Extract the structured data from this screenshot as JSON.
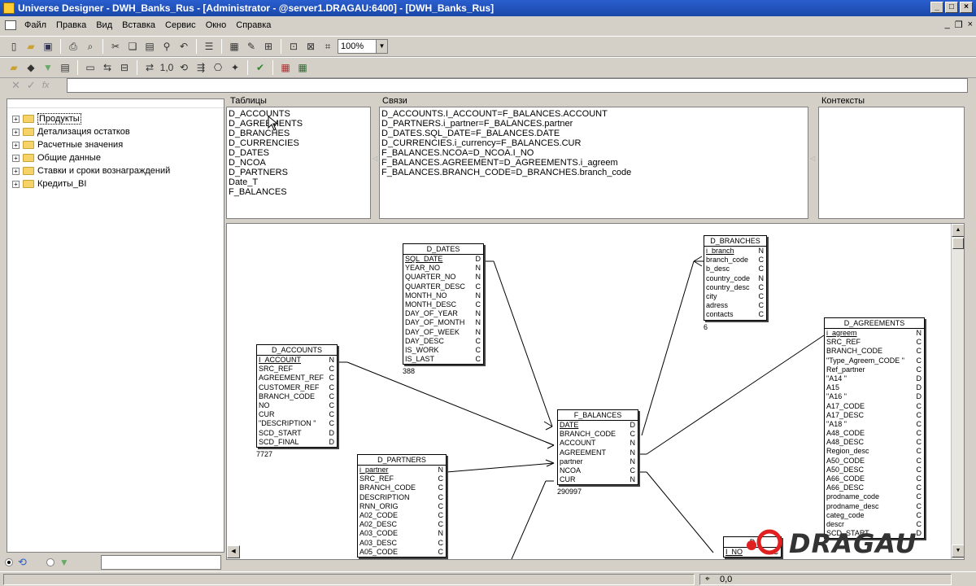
{
  "window": {
    "title": "Universe Designer - DWH_Banks_Rus - [Administrator - @server1.DRAGAU:6400] - [DWH_Banks_Rus]"
  },
  "menu": [
    "Файл",
    "Правка",
    "Вид",
    "Вставка",
    "Сервис",
    "Окно",
    "Справка"
  ],
  "toolbar": {
    "zoom": "100%"
  },
  "tree": {
    "items": [
      "Продукты",
      "Детализация остатков",
      "Расчетные значения",
      "Общие данные",
      "Ставки и сроки вознаграждений",
      "Кредиты_BI"
    ]
  },
  "panels": {
    "tables": {
      "label": "Таблицы",
      "items": [
        "D_ACCOUNTS",
        "D_AGREEMENTS",
        "D_BRANCHES",
        "D_CURRENCIES",
        "D_DATES",
        "D_NCOA",
        "D_PARTNERS",
        "Date_T",
        "F_BALANCES"
      ]
    },
    "joins": {
      "label": "Связи",
      "items": [
        "D_ACCOUNTS.I_ACCOUNT=F_BALANCES.ACCOUNT",
        "D_PARTNERS.i_partner=F_BALANCES.partner",
        "D_DATES.SQL_DATE=F_BALANCES.DATE",
        "D_CURRENCIES.i_currency=F_BALANCES.CUR",
        "F_BALANCES.NCOA=D_NCOA.I_NO",
        "F_BALANCES.AGREEMENT=D_AGREEMENTS.i_agreem",
        "F_BALANCES.BRANCH_CODE=D_BRANCHES.branch_code"
      ]
    },
    "contexts": {
      "label": "Контексты",
      "items": []
    }
  },
  "tables": {
    "d_dates": {
      "name": "D_DATES",
      "count": "388",
      "cols": [
        [
          "SQL_DATE",
          "D"
        ],
        [
          "YEAR_NO",
          "N"
        ],
        [
          "QUARTER_NO",
          "N"
        ],
        [
          "QUARTER_DESC",
          "C"
        ],
        [
          "MONTH_NO",
          "N"
        ],
        [
          "MONTH_DESC",
          "C"
        ],
        [
          "DAY_OF_YEAR",
          "N"
        ],
        [
          "DAY_OF_MONTH",
          "N"
        ],
        [
          "DAY_OF_WEEK",
          "N"
        ],
        [
          "DAY_DESC",
          "C"
        ],
        [
          "IS_WORK",
          "C"
        ],
        [
          "IS_LAST",
          "C"
        ]
      ]
    },
    "d_branches": {
      "name": "D_BRANCHES",
      "count": "6",
      "cols": [
        [
          "i_branch",
          "N"
        ],
        [
          "branch_code",
          "C"
        ],
        [
          "b_desc",
          "C"
        ],
        [
          "country_code",
          "N"
        ],
        [
          "country_desc",
          "C"
        ],
        [
          "city",
          "C"
        ],
        [
          "adress",
          "C"
        ],
        [
          "contacts",
          "C"
        ]
      ]
    },
    "d_accounts": {
      "name": "D_ACCOUNTS",
      "count": "7727",
      "cols": [
        [
          "I_ACCOUNT",
          "N"
        ],
        [
          "SRC_REF",
          "C"
        ],
        [
          "AGREEMENT_REF",
          "C"
        ],
        [
          "CUSTOMER_REF",
          "C"
        ],
        [
          "BRANCH_CODE",
          "C"
        ],
        [
          "NO",
          "C"
        ],
        [
          "CUR",
          "C"
        ],
        [
          "\"DESCRIPTION \"",
          "C"
        ],
        [
          "SCD_START",
          "D"
        ],
        [
          "SCD_FINAL",
          "D"
        ]
      ]
    },
    "f_balances": {
      "name": "F_BALANCES",
      "count": "290997",
      "cols": [
        [
          "DATE",
          "D"
        ],
        [
          "BRANCH_CODE",
          "C"
        ],
        [
          "ACCOUNT",
          "N"
        ],
        [
          "AGREEMENT",
          "N"
        ],
        [
          "partner",
          "N"
        ],
        [
          "NCOA",
          "C"
        ],
        [
          "CUR",
          "N"
        ]
      ]
    },
    "d_partners": {
      "name": "D_PARTNERS",
      "cols": [
        [
          "i_partner",
          "N"
        ],
        [
          "SRC_REF",
          "C"
        ],
        [
          "BRANCH_CODE",
          "C"
        ],
        [
          "DESCRIPTION",
          "C"
        ],
        [
          "RNN_ORIG",
          "C"
        ],
        [
          "A02_CODE",
          "C"
        ],
        [
          "A02_DESC",
          "C"
        ],
        [
          "A03_CODE",
          "N"
        ],
        [
          "A03_DESC",
          "C"
        ],
        [
          "A05_CODE",
          "C"
        ]
      ]
    },
    "d_agreements": {
      "name": "D_AGREEMENTS",
      "cols": [
        [
          "i_agreem",
          "N"
        ],
        [
          "SRC_REF",
          "C"
        ],
        [
          "BRANCH_CODE",
          "C"
        ],
        [
          "\"Type_Agreem_CODE \"",
          "C"
        ],
        [
          "Ref_partner",
          "C"
        ],
        [
          "\"A14 \"",
          "D"
        ],
        [
          "A15",
          "D"
        ],
        [
          "\"A16 \"",
          "D"
        ],
        [
          "A17_CODE",
          "C"
        ],
        [
          "A17_DESC",
          "C"
        ],
        [
          "\"A18 \"",
          "C"
        ],
        [
          "A48_CODE",
          "C"
        ],
        [
          "A48_DESC",
          "C"
        ],
        [
          "Region_desc",
          "C"
        ],
        [
          "A50_CODE",
          "C"
        ],
        [
          "A50_DESC",
          "C"
        ],
        [
          "A66_CODE",
          "C"
        ],
        [
          "A66_DESC",
          "C"
        ],
        [
          "prodname_code",
          "C"
        ],
        [
          "prodname_desc",
          "C"
        ],
        [
          "categ_code",
          "C"
        ],
        [
          "descr",
          "C"
        ],
        [
          "SCD_START",
          "D"
        ]
      ]
    },
    "d_ncoa": {
      "name": "D",
      "cols": [
        [
          "I_NO",
          "C"
        ]
      ]
    }
  },
  "status": {
    "coords": "0,0"
  },
  "logo": {
    "text": "DRAGAU"
  },
  "colors": {
    "titlebar": "#1a46a8",
    "logo_red": "#e02020"
  }
}
